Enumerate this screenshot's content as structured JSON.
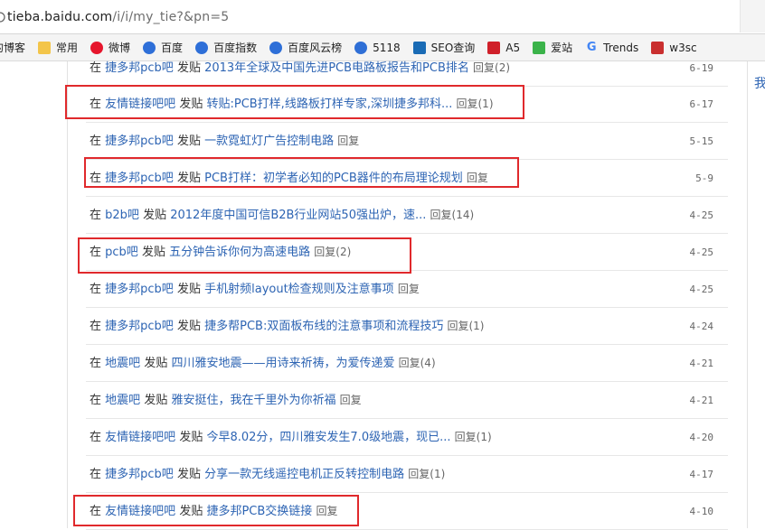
{
  "address": {
    "host": "tieba.baidu.com",
    "path": "/i/i/my_tie?&pn=5"
  },
  "bookmarks": [
    {
      "label": "的博客",
      "icon": "blog-icon",
      "color": "#ffffff"
    },
    {
      "label": "常用",
      "icon": "folder-icon",
      "color": "#f3c54a"
    },
    {
      "label": "微博",
      "icon": "weibo-icon",
      "color": "#e6162d"
    },
    {
      "label": "百度",
      "icon": "baidu-paw-icon",
      "color": "#2e6fd8"
    },
    {
      "label": "百度指数",
      "icon": "baidu-paw-icon",
      "color": "#2e6fd8"
    },
    {
      "label": "百度风云榜",
      "icon": "baidu-paw-icon",
      "color": "#2e6fd8"
    },
    {
      "label": "5118",
      "icon": "5118-icon",
      "color": "#2f6fd6"
    },
    {
      "label": "SEO查询",
      "icon": "seo-icon",
      "color": "#1a6bb5"
    },
    {
      "label": "A5",
      "icon": "a5-icon",
      "color": "#d0202a"
    },
    {
      "label": "爱站",
      "icon": "aizhan-icon",
      "color": "#3bb34a"
    },
    {
      "label": "Trends",
      "icon": "google-icon",
      "color": "#4285f4"
    },
    {
      "label": "w3sc",
      "icon": "w3-icon",
      "color": "#c92f2f"
    }
  ],
  "right_glyph": "我",
  "rows": [
    {
      "prefix": "在",
      "forum": "捷多邦pcb吧",
      "action": "发贴",
      "title": "2013年全球及中国先进PCB电路板报告和PCB排名",
      "reply": "回复(2)",
      "date": "6-19"
    },
    {
      "prefix": "在",
      "forum": "友情链接吧吧",
      "action": "发贴",
      "title": "转贴:PCB打样,线路板打样专家,深圳捷多邦科...",
      "reply": "回复(1)",
      "date": "6-17"
    },
    {
      "prefix": "在",
      "forum": "捷多邦pcb吧",
      "action": "发贴",
      "title": "一款霓虹灯广告控制电路",
      "reply": "回复",
      "date": "5-15"
    },
    {
      "prefix": "在",
      "forum": "捷多邦pcb吧",
      "action": "发贴",
      "title": "PCB打样：初学者必知的PCB器件的布局理论规划",
      "reply": "回复",
      "date": "5-9"
    },
    {
      "prefix": "在",
      "forum": "b2b吧",
      "action": "发贴",
      "title": "2012年度中国可信B2B行业网站50强出炉，速...",
      "reply": "回复(14)",
      "date": "4-25"
    },
    {
      "prefix": "在",
      "forum": "pcb吧",
      "action": "发贴",
      "title": "五分钟告诉你何为高速电路",
      "reply": "回复(2)",
      "date": "4-25"
    },
    {
      "prefix": "在",
      "forum": "捷多邦pcb吧",
      "action": "发贴",
      "title": "手机射频layout检查规则及注意事项",
      "reply": "回复",
      "date": "4-25"
    },
    {
      "prefix": "在",
      "forum": "捷多邦pcb吧",
      "action": "发贴",
      "title": "捷多帮PCB:双面板布线的注意事项和流程技巧",
      "reply": "回复(1)",
      "date": "4-24"
    },
    {
      "prefix": "在",
      "forum": "地震吧",
      "action": "发贴",
      "title": "四川雅安地震——用诗来祈祷，为爱传递爱",
      "reply": "回复(4)",
      "date": "4-21"
    },
    {
      "prefix": "在",
      "forum": "地震吧",
      "action": "发贴",
      "title": "雅安挺住，我在千里外为你祈福",
      "reply": "回复",
      "date": "4-21"
    },
    {
      "prefix": "在",
      "forum": "友情链接吧吧",
      "action": "发贴",
      "title": "今早8.02分，四川雅安发生7.0级地震，现已...",
      "reply": "回复(1)",
      "date": "4-20"
    },
    {
      "prefix": "在",
      "forum": "捷多邦pcb吧",
      "action": "发贴",
      "title": "分享一款无线遥控电机正反转控制电路",
      "reply": "回复(1)",
      "date": "4-17"
    },
    {
      "prefix": "在",
      "forum": "友情链接吧吧",
      "action": "发贴",
      "title": "捷多邦PCB交换链接",
      "reply": "回复",
      "date": "4-10"
    }
  ],
  "colors": {
    "link": "#2d64b3",
    "highlight": "#e0292c"
  }
}
